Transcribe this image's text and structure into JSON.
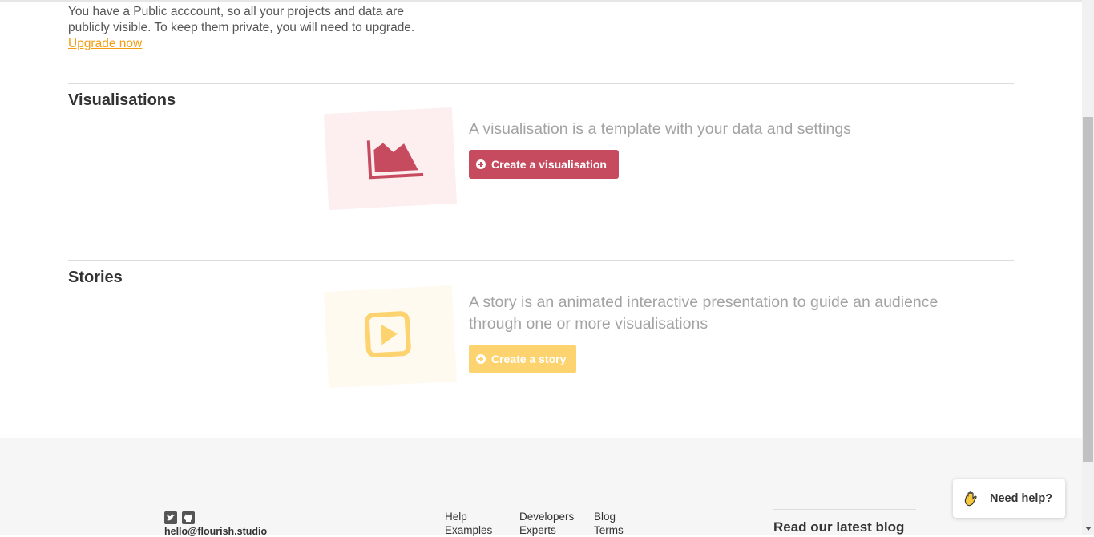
{
  "account_notice": {
    "text": "You have a Public acccount, so all your projects and data are publicly visible. To keep them private, you will need to upgrade.",
    "link_label": "Upgrade now"
  },
  "visualisations": {
    "title": "Visualisations",
    "description": "A visualisation is a template with your data and settings",
    "button_label": "Create a visualisation",
    "icon": "area-chart-icon",
    "accent": "#c64b5f"
  },
  "stories": {
    "title": "Stories",
    "description": "A story is an animated interactive presentation to guide an audience through one or more visualisations",
    "button_label": "Create a story",
    "icon": "play-icon",
    "accent": "#fcd36f"
  },
  "footer": {
    "email": "hello@flourish.studio",
    "social_icons": [
      "twitter-icon",
      "github-icon"
    ],
    "col1": [
      "Help",
      "Examples"
    ],
    "col2": [
      "Developers",
      "Experts"
    ],
    "col3": [
      "Blog",
      "Terms"
    ],
    "blog_heading": "Read our latest blog"
  },
  "help_widget": {
    "label": "Need help?",
    "icon": "waving-hand-icon"
  }
}
